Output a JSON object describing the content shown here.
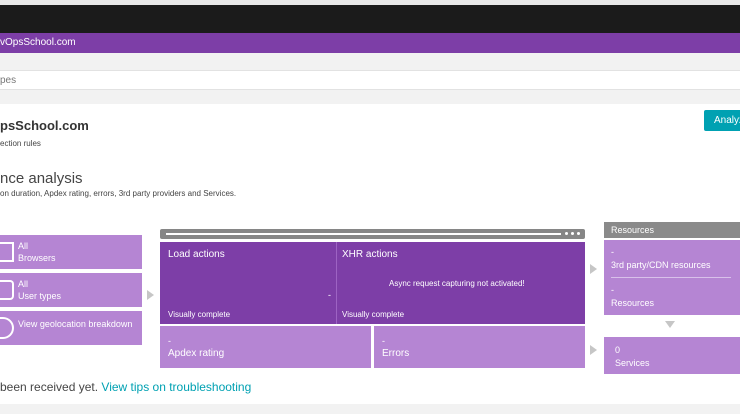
{
  "header": {
    "app_breadcrumb": "vOpsSchool.com"
  },
  "filter": {
    "text": "pes"
  },
  "app": {
    "title": "psSchool.com",
    "sublink": "ection rules",
    "analyze_button": "Analyz"
  },
  "section": {
    "title": "nce analysis",
    "description": "on duration, Apdex rating, errors, 3rd party providers and Services."
  },
  "filters": {
    "browsers": {
      "line1": "All",
      "line2": "Browsers"
    },
    "user_types": {
      "line1": "All",
      "line2": "User types"
    },
    "geolocation": {
      "label": "View geolocation breakdown"
    }
  },
  "metrics": {
    "load_actions": {
      "title": "Load actions",
      "value": "-",
      "subtitle": "Visually complete"
    },
    "xhr_actions": {
      "title": "XHR actions",
      "message": "Async request capturing not activated!",
      "subtitle": "Visually complete"
    },
    "apdex": {
      "value": "-",
      "label": "Apdex rating"
    },
    "errors": {
      "value": "-",
      "label": "Errors"
    }
  },
  "resources": {
    "header": "Resources",
    "third_party": {
      "value": "-",
      "label": "3rd party/CDN resources"
    },
    "resources": {
      "value": "-",
      "label": "Resources"
    },
    "services": {
      "value": "0",
      "label": "Services"
    }
  },
  "footer": {
    "message": " been received yet. ",
    "link": "View tips on troubleshooting"
  },
  "colors": {
    "purple_dark": "#7d3ea7",
    "purple_light": "#b585d3",
    "accent": "#00a1b2"
  }
}
